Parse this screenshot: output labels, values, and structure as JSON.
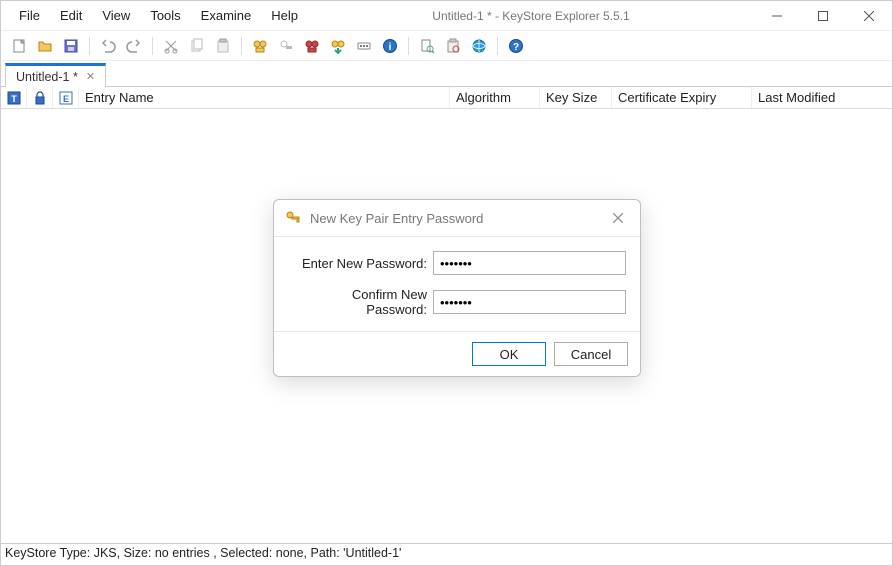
{
  "window": {
    "title": "Untitled-1 * - KeyStore Explorer 5.5.1"
  },
  "menu": {
    "file": "File",
    "edit": "Edit",
    "view": "View",
    "tools": "Tools",
    "examine": "Examine",
    "help": "Help"
  },
  "tabs": {
    "active": "Untitled-1 *"
  },
  "columns": {
    "entry": "Entry Name",
    "algorithm": "Algorithm",
    "keysize": "Key Size",
    "expiry": "Certificate Expiry",
    "modified": "Last Modified"
  },
  "dialog": {
    "title": "New Key Pair Entry Password",
    "enter_label": "Enter New Password:",
    "confirm_label": "Confirm New Password:",
    "enter_value": "•••••••",
    "confirm_value": "•••••••",
    "ok": "OK",
    "cancel": "Cancel"
  },
  "status": {
    "text": "KeyStore Type: JKS, Size: no entries , Selected: none, Path: 'Untitled-1'"
  }
}
